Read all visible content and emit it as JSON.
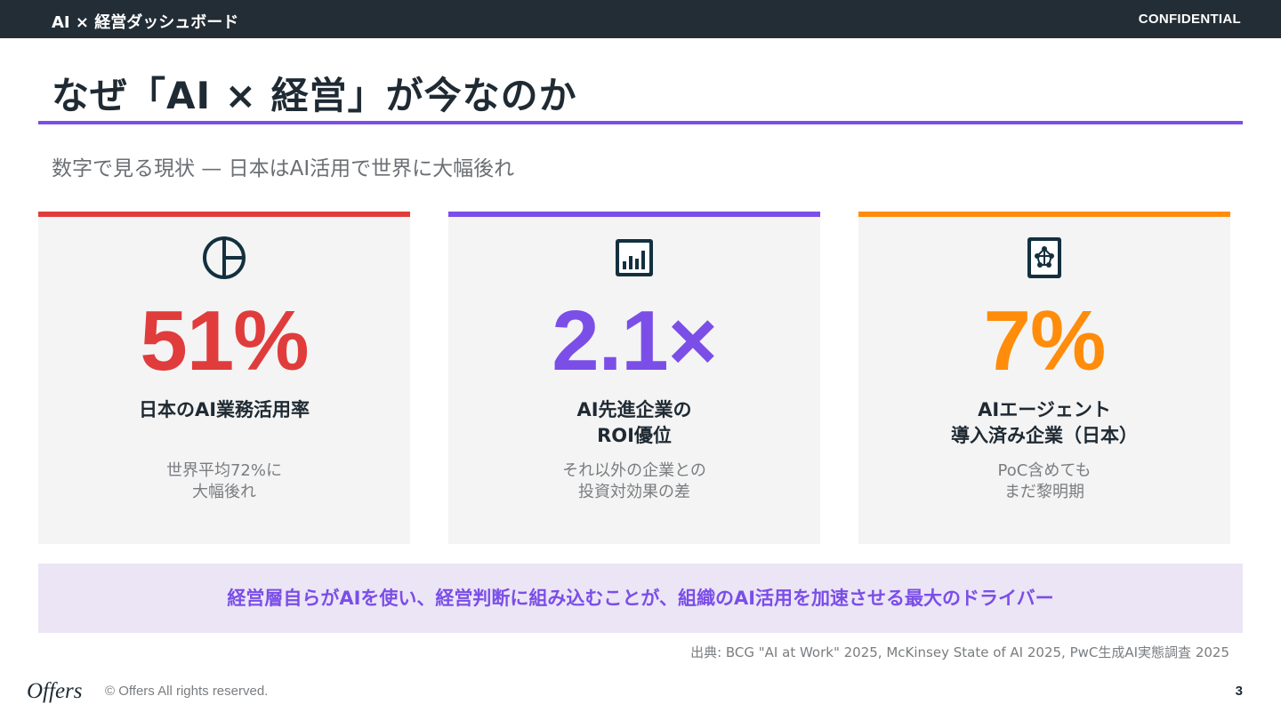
{
  "header": {
    "deck_title": "AI × 経営ダッシュボード",
    "confidentiality": "CONFIDENTIAL"
  },
  "slide": {
    "title": "なぜ「AI × 経営」が今なのか",
    "subtitle": "数字で見る現状 — 日本はAI活用で世界に大幅後れ",
    "accent_color": "#7b4ee8"
  },
  "cards": [
    {
      "icon": "pie-chart-icon",
      "value": "51%",
      "label": "日本のAI業務活用率",
      "note": "世界平均72%に\n大幅後れ",
      "color": "#e03c3c"
    },
    {
      "icon": "bar-chart-icon",
      "value": "2.1×",
      "label": "AI先進企業の\nROI優位",
      "note": "それ以外の企業との\n投資対効果の差",
      "color": "#7b4ee8"
    },
    {
      "icon": "network-document-icon",
      "value": "7%",
      "label": "AIエージェント\n導入済み企業（日本）",
      "note": "PoC含めても\nまだ黎明期",
      "color": "#ff8c0a"
    }
  ],
  "callout": {
    "text": "経営層自らがAIを使い、経営判断に組み込むことが、組織のAI活用を加速させる最大のドライバー"
  },
  "source": "出典: BCG \"AI at Work\" 2025, McKinsey State of AI 2025, PwC生成AI実態調査 2025",
  "footer": {
    "logo_text": "Offers",
    "copyright": "© Offers All rights reserved.",
    "page_number": "3"
  }
}
